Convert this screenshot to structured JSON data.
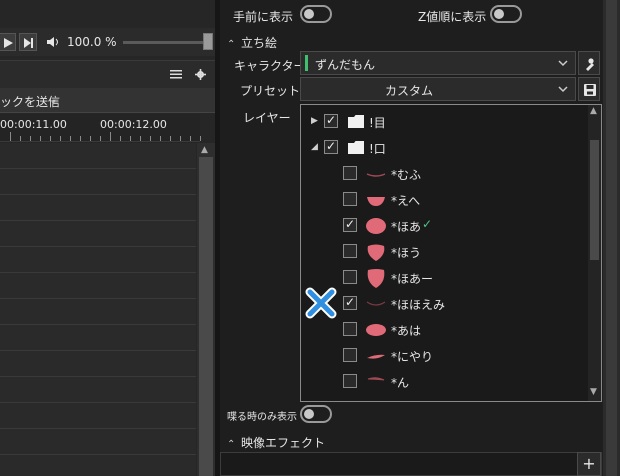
{
  "transport": {
    "volume_text": "100.0 %"
  },
  "timeline": {
    "send_label": "ックを送信",
    "ruler_times": [
      "00:00:11.00",
      "00:00:12.00"
    ]
  },
  "panel": {
    "top_toggles": [
      {
        "label": "手前に表示",
        "state": "off"
      },
      {
        "label": "Z値順に表示",
        "state": "off"
      }
    ],
    "section_tachie": "立ち絵",
    "character": {
      "label": "キャラクター",
      "value": "ずんだもん",
      "accent_color": "#3fbf6f"
    },
    "preset": {
      "label": "プリセット",
      "value": "カスタム"
    },
    "layer_label": "レイヤー",
    "layers": [
      {
        "name": "!目",
        "kind": "folder",
        "checked": true,
        "expander": "collapsed"
      },
      {
        "name": "!口",
        "kind": "folder",
        "checked": true,
        "expander": "expanded"
      },
      {
        "name": "*むふ",
        "kind": "mouth",
        "checked": false,
        "icon": "mouth-mufu-icon"
      },
      {
        "name": "*えへ",
        "kind": "mouth",
        "checked": false,
        "icon": "mouth-ehe-icon"
      },
      {
        "name": "*ほあ",
        "kind": "mouth",
        "checked": true,
        "icon": "mouth-hoa-icon",
        "selected": true
      },
      {
        "name": "*ほう",
        "kind": "mouth",
        "checked": false,
        "icon": "mouth-hou-icon"
      },
      {
        "name": "*ほあー",
        "kind": "mouth",
        "checked": false,
        "icon": "mouth-hoaa-icon"
      },
      {
        "name": "*ほほえみ",
        "kind": "mouth",
        "checked": true,
        "icon": "mouth-hohoemi-icon"
      },
      {
        "name": "*あは",
        "kind": "mouth",
        "checked": false,
        "icon": "mouth-aha-icon"
      },
      {
        "name": "*にやり",
        "kind": "mouth",
        "checked": false,
        "icon": "mouth-niyari-icon"
      },
      {
        "name": "*ん",
        "kind": "mouth",
        "checked": false,
        "icon": "mouth-n-icon"
      }
    ],
    "speak_only": {
      "label": "喋る時のみ表示",
      "state": "off"
    },
    "section_effect": "映像エフェクト",
    "add_label": "+"
  },
  "colors": {
    "mouth_fill": "#e06a78",
    "check_mark": "#4fc38a",
    "x_mark": "#2f8fe0"
  }
}
